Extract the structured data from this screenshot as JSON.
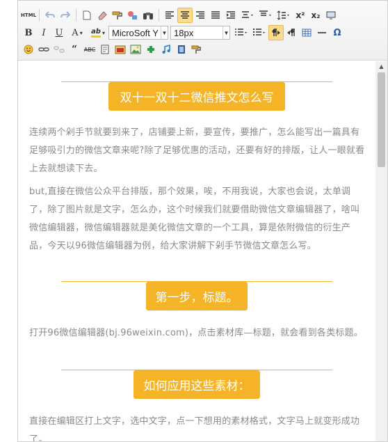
{
  "toolbar": {
    "font_family": "MicroSoft Y",
    "font_size": "18px",
    "html_label": "HTML",
    "bold": "B",
    "italic": "I",
    "underline": "U",
    "font_color": "A",
    "bg_color": "ab",
    "superscript": "x²",
    "subscript": "x₂",
    "omega": "Ω",
    "quote": "66",
    "strike": "ABC"
  },
  "article": {
    "title1": "双十一双十二微信推文怎么写",
    "para1": "连续两个剁手节就要到来了，店铺要上新，要宣传，要推广，怎么能写出一篇具有足够吸引力的微信文章来呢?除了足够优惠的活动，还要有好的排版，让人一眼就看上去就想读下去。",
    "para2": "but,直接在微信公众平台排版，那个效果，唉，不用我说，大家也会说，太单调了，除了图片就是文字，怎么办，这个时候我们就要借助微信文章编辑器了，啥叫微信编辑器，微信编辑器就是美化微信文章的一个工具，算是依附微信的衍生产品，今天以96微信编辑器为例，给大家讲解下剁手节微信文章怎么写。",
    "title2": "第一步，标题。",
    "para3": "打开96微信编辑器(bj.96weixin.com)，点击素材库—标题，就会看到各类标题。",
    "title3": "如何应用这些素材：",
    "para4": "直接在编辑区打上文字，选中文字，点一下想用的素材格式，文字马上就变形成功了。"
  },
  "colors": {
    "accent": "#f5b428",
    "body_text": "#8a8a8a",
    "active_button": "#fbdb8e"
  }
}
